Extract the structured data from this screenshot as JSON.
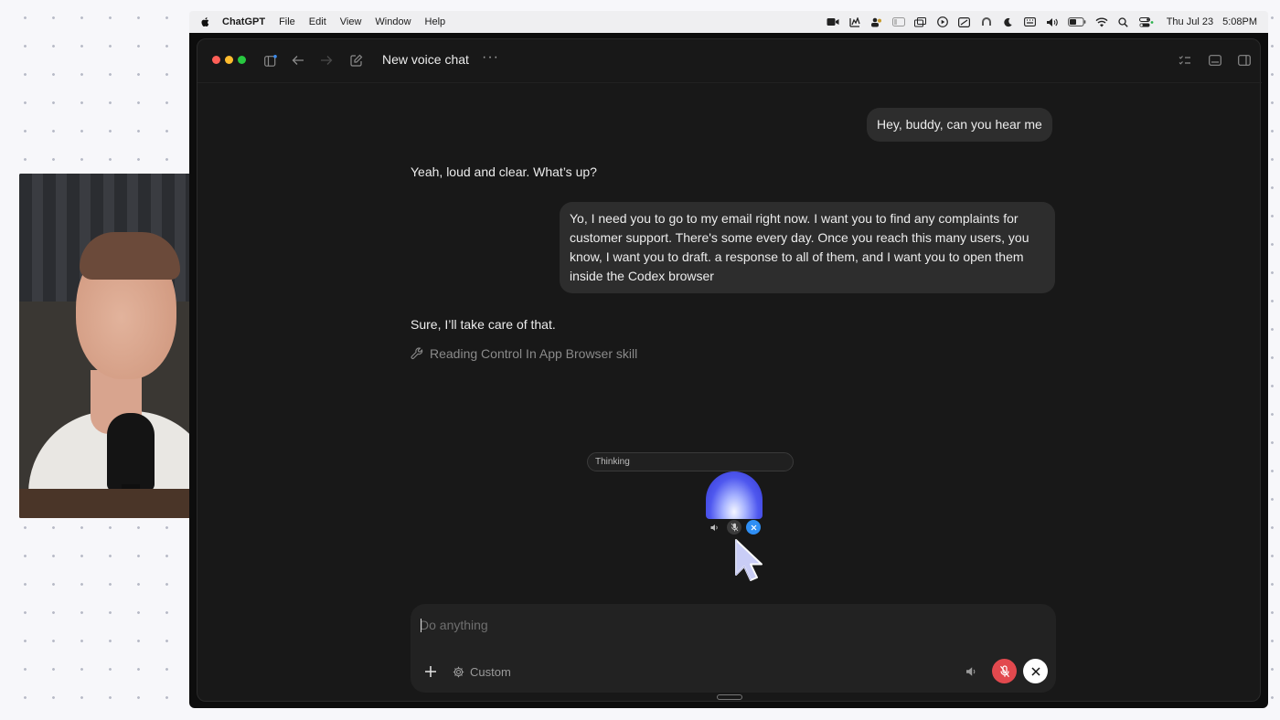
{
  "menubar": {
    "app_name": "ChatGPT",
    "menus": [
      "File",
      "Edit",
      "View",
      "Window",
      "Help"
    ],
    "status_icons": [
      "camera-icon",
      "chart-icon",
      "users-icon",
      "tag-icon",
      "windows-icon",
      "play-icon",
      "screen-icon",
      "airdrop-icon",
      "moon-icon",
      "keyboard-icon",
      "volume-icon",
      "battery-icon",
      "wifi-icon",
      "search-icon",
      "control-center-icon"
    ],
    "clock": {
      "date": "Thu Jul 23",
      "time": "5:08PM"
    }
  },
  "window": {
    "title": "New voice chat",
    "more_label": "···",
    "traffic_lights": {
      "close": "#ff5f57",
      "minimize": "#febc2e",
      "zoom": "#28c840"
    },
    "accent_dot": "#3b8cf0"
  },
  "conversation": [
    {
      "role": "user",
      "text": "Hey, buddy, can you hear me"
    },
    {
      "role": "assistant",
      "text": "Yeah, loud and clear. What’s up?"
    },
    {
      "role": "user",
      "text": " Yo, I need you to go to my email right now. I want you to find any complaints for customer support. There's some every day. Once you reach this many users, you know, I want you to draft. a response to all of them, and I want you to open them inside the Codex browser"
    },
    {
      "role": "assistant",
      "text": "Sure, I’ll take care of that."
    }
  ],
  "skill_status": {
    "icon": "wrench-icon",
    "text": "Reading Control In App Browser skill"
  },
  "voice_widget": {
    "status": "Thinking",
    "orb_color": "#4f58ef",
    "close_color": "#2f8ff5"
  },
  "composer": {
    "placeholder": "Do anything",
    "value": "",
    "mode_label": "Custom",
    "mute_color": "#e2494e"
  }
}
